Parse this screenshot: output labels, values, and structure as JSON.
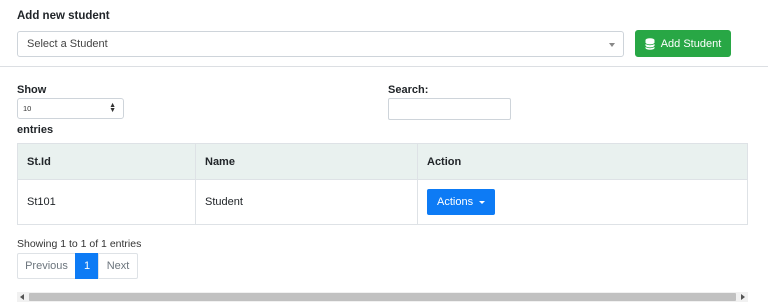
{
  "add_student": {
    "label": "Add new student",
    "select_placeholder": "Select a Student",
    "add_button_label": "Add Student"
  },
  "table_controls": {
    "show_label": "Show",
    "entries_label": "entries",
    "length_value": "10",
    "search_label": "Search:",
    "search_value": ""
  },
  "table": {
    "headers": [
      "St.Id",
      "Name",
      "Action"
    ],
    "rows": [
      {
        "id": "St101",
        "name": "Student",
        "action_label": "Actions"
      }
    ]
  },
  "info": "Showing 1 to 1 of 1 entries",
  "pagination": {
    "previous": "Previous",
    "current": "1",
    "next": "Next"
  },
  "colors": {
    "success": "#28a745",
    "primary": "#0d7bf5",
    "table_header_bg": "#e9f1ef"
  }
}
